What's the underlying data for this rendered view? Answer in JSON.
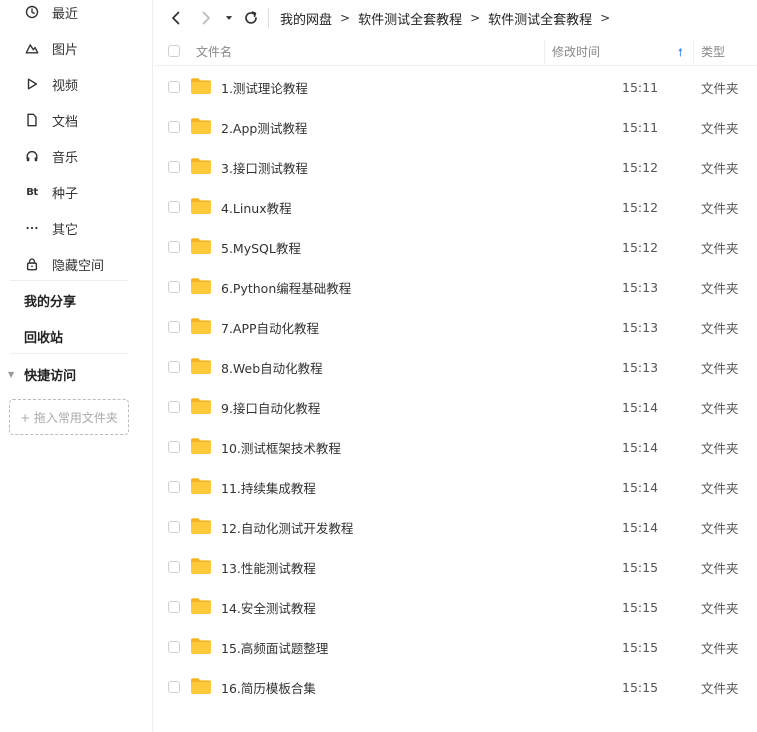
{
  "sidebar": {
    "items": [
      {
        "label": "最近",
        "icon": "clock-icon"
      },
      {
        "label": "图片",
        "icon": "image-icon"
      },
      {
        "label": "视频",
        "icon": "play-icon"
      },
      {
        "label": "文档",
        "icon": "document-icon"
      },
      {
        "label": "音乐",
        "icon": "headphones-icon"
      },
      {
        "label": "种子",
        "icon": "bt-icon",
        "glyph": "Bt"
      },
      {
        "label": "其它",
        "icon": "more-icon"
      },
      {
        "label": "隐藏空间",
        "icon": "lock-icon"
      }
    ],
    "my_share": "我的分享",
    "recycle_bin": "回收站",
    "quick_access": "快捷访问",
    "drop_zone": "+ 拖入常用文件夹"
  },
  "breadcrumb": {
    "items": [
      "我的网盘",
      "软件测试全套教程",
      "软件测试全套教程"
    ]
  },
  "table": {
    "columns": {
      "name": "文件名",
      "modified": "修改时间",
      "type": "类型"
    },
    "rows": [
      {
        "name": "1.测试理论教程",
        "time": "15:11",
        "type": "文件夹"
      },
      {
        "name": "2.App测试教程",
        "time": "15:11",
        "type": "文件夹"
      },
      {
        "name": "3.接口测试教程",
        "time": "15:12",
        "type": "文件夹"
      },
      {
        "name": "4.Linux教程",
        "time": "15:12",
        "type": "文件夹"
      },
      {
        "name": "5.MySQL教程",
        "time": "15:12",
        "type": "文件夹"
      },
      {
        "name": "6.Python编程基础教程",
        "time": "15:13",
        "type": "文件夹"
      },
      {
        "name": "7.APP自动化教程",
        "time": "15:13",
        "type": "文件夹"
      },
      {
        "name": "8.Web自动化教程",
        "time": "15:13",
        "type": "文件夹"
      },
      {
        "name": "9.接口自动化教程",
        "time": "15:14",
        "type": "文件夹"
      },
      {
        "name": "10.测试框架技术教程",
        "time": "15:14",
        "type": "文件夹"
      },
      {
        "name": "11.持续集成教程",
        "time": "15:14",
        "type": "文件夹"
      },
      {
        "name": "12.自动化测试开发教程",
        "time": "15:14",
        "type": "文件夹"
      },
      {
        "name": "13.性能测试教程",
        "time": "15:15",
        "type": "文件夹"
      },
      {
        "name": "14.安全测试教程",
        "time": "15:15",
        "type": "文件夹"
      },
      {
        "name": "15.高频面试题整理",
        "time": "15:15",
        "type": "文件夹"
      },
      {
        "name": "16.简历模板合集",
        "time": "15:15",
        "type": "文件夹"
      }
    ]
  },
  "colors": {
    "folder": "#FFC93C",
    "folder_tab": "#F5B51F",
    "sort_arrow": "#3B82F6"
  }
}
